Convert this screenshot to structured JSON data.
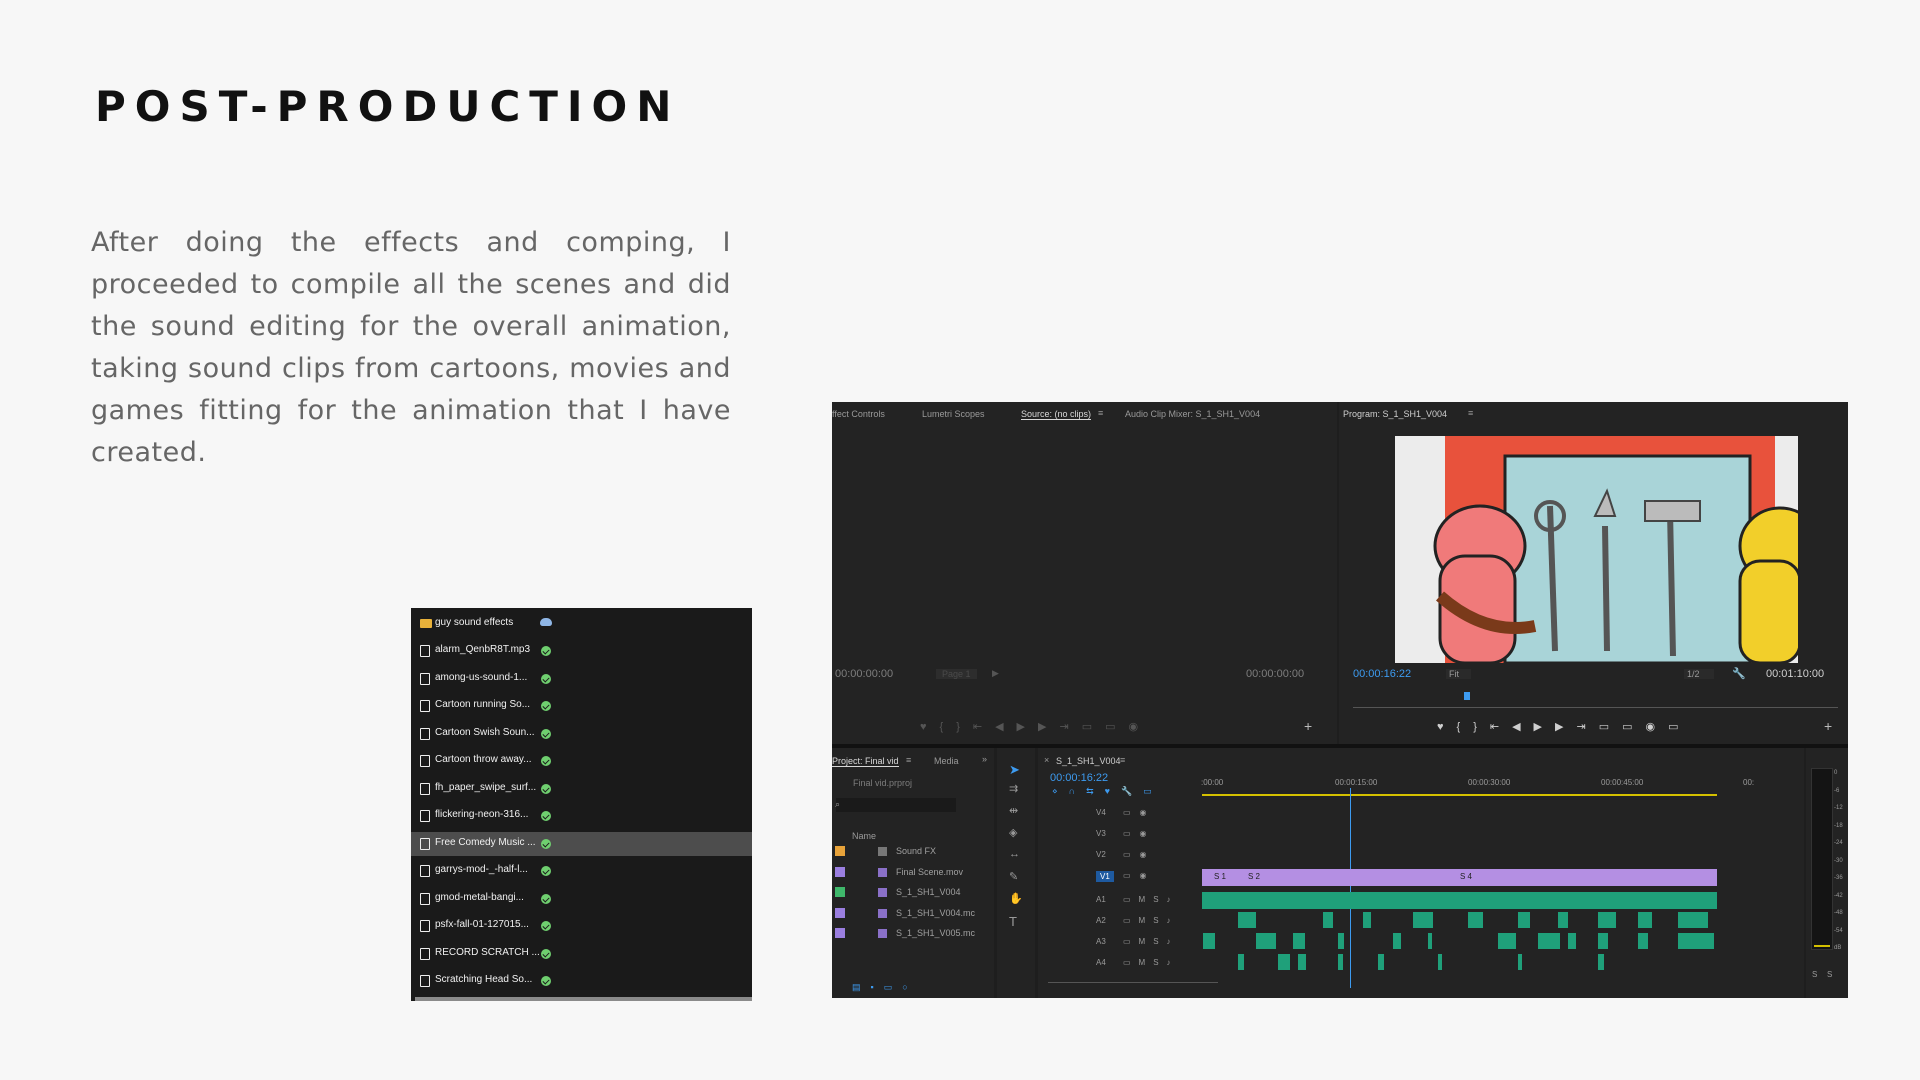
{
  "page": {
    "title": "POST-PRODUCTION",
    "paragraph": "After doing the effects and comping, I proceeded to compile all the scenes and did the sound editing for the overall animation, taking sound clips from cartoons, movies and games fitting for the animation that I have created."
  },
  "file_list": {
    "folder": "guy sound effects",
    "items": [
      "alarm_QenbR8T.mp3",
      "among-us-sound-1...",
      "Cartoon running So...",
      "Cartoon Swish Soun...",
      "Cartoon throw away...",
      "fh_paper_swipe_surf...",
      "flickering-neon-316...",
      "Free Comedy Music ...",
      "garrys-mod-_-half-l...",
      "gmod-metal-bangi...",
      "psfx-fall-01-127015...",
      "RECORD SCRATCH ...",
      "Scratching Head So..."
    ],
    "selected_index": 7
  },
  "premiere": {
    "source_tabs": [
      "ffect Controls",
      "Lumetri Scopes",
      "Source: (no clips)",
      "Audio Clip Mixer: S_1_SH1_V004"
    ],
    "source_tc_left": "00:00:00:00",
    "source_tc_right": "00:00:00:00",
    "source_page": "Page 1",
    "program_tab": "Program: S_1_SH1_V004",
    "program_tc": "00:00:16:22",
    "program_fit": "Fit",
    "program_res": "1/2",
    "program_duration": "00:01:10:00",
    "project_tabs": [
      "Project: Final vid",
      "Media"
    ],
    "project_file": "Final vid.prproj",
    "bin_header": "Name",
    "bin_items": [
      {
        "name": "Sound FX",
        "color": "#e8a33a"
      },
      {
        "name": "Final Scene.mov",
        "color": "#9b7fe0"
      },
      {
        "name": "S_1_SH1_V004",
        "color": "#3fb86b"
      },
      {
        "name": "S_1_SH1_V004.mc",
        "color": "#9b7fe0"
      },
      {
        "name": "S_1_SH1_V005.mc",
        "color": "#9b7fe0"
      }
    ],
    "timeline_tab": "S_1_SH1_V004",
    "timeline_tc": "00:00:16:22",
    "ruler": [
      ":00:00",
      "00:00:15:00",
      "00:00:30:00",
      "00:00:45:00",
      "00:"
    ],
    "video_tracks": [
      "V4",
      "V3",
      "V2",
      "V1"
    ],
    "audio_tracks": [
      "A1",
      "A2",
      "A3",
      "A4"
    ],
    "clip_labels": [
      "S 1",
      "S 2",
      "S 4"
    ],
    "meter_scale": [
      "0",
      "-6",
      "-12",
      "-18",
      "-24",
      "-30",
      "-36",
      "-42",
      "-48",
      "-54",
      "dB"
    ],
    "meter_buttons": [
      "S",
      "S"
    ]
  }
}
